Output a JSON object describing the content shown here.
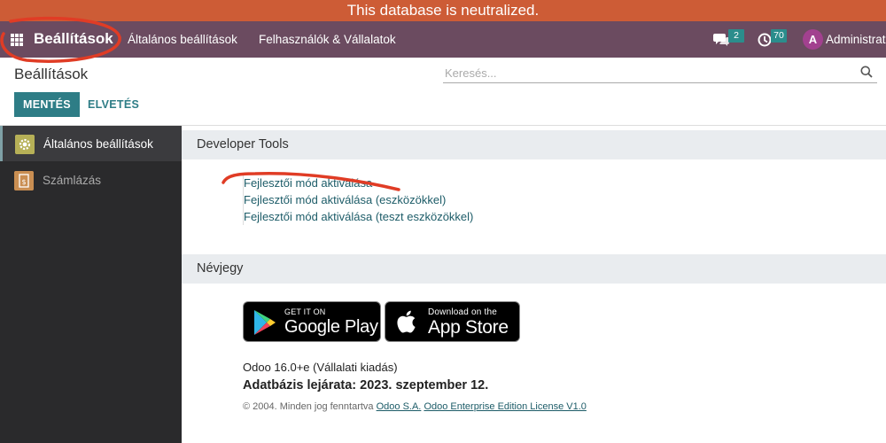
{
  "banner": {
    "text": "This database is neutralized."
  },
  "navbar": {
    "brand": "Beállítások",
    "menu": [
      "Általános beállítások",
      "Felhasználók & Vállalatok"
    ],
    "messages_count": "2",
    "activities_count": "70",
    "user_initial": "A",
    "user_name": "Administrator"
  },
  "control_panel": {
    "breadcrumb": "Beállítások",
    "search_placeholder": "Keresés...",
    "save_label": "MENTÉS",
    "discard_label": "ELVETÉS"
  },
  "sidebar": {
    "items": [
      {
        "label": "Általános beállítások",
        "icon": "gear-icon"
      },
      {
        "label": "Számlázás",
        "icon": "invoice-icon"
      }
    ]
  },
  "developer_tools": {
    "title": "Developer Tools",
    "links": [
      "Fejlesztői mód aktiválása",
      "Fejlesztői mód aktiválása (eszközökkel)",
      "Fejlesztői mód aktiválása (teszt eszközökkel)"
    ]
  },
  "about": {
    "title": "Névjegy",
    "google_play_small": "GET IT ON",
    "google_play_big": "Google Play",
    "app_store_small": "Download on the",
    "app_store_big": "App Store",
    "version": "Odoo 16.0+e (Vállalati kiadás)",
    "expiry": "Adatbázis lejárata: 2023. szeptember 12.",
    "copyright_prefix": "© 2004. Minden jog fenntartva",
    "company_link": "Odoo S.A.",
    "license_link": "Odoo Enterprise Edition License V1.0"
  },
  "colors": {
    "banner": "#cd5c36",
    "navbar": "#6b4b60",
    "accent": "#2e7d86",
    "annotation": "#e03c25"
  }
}
